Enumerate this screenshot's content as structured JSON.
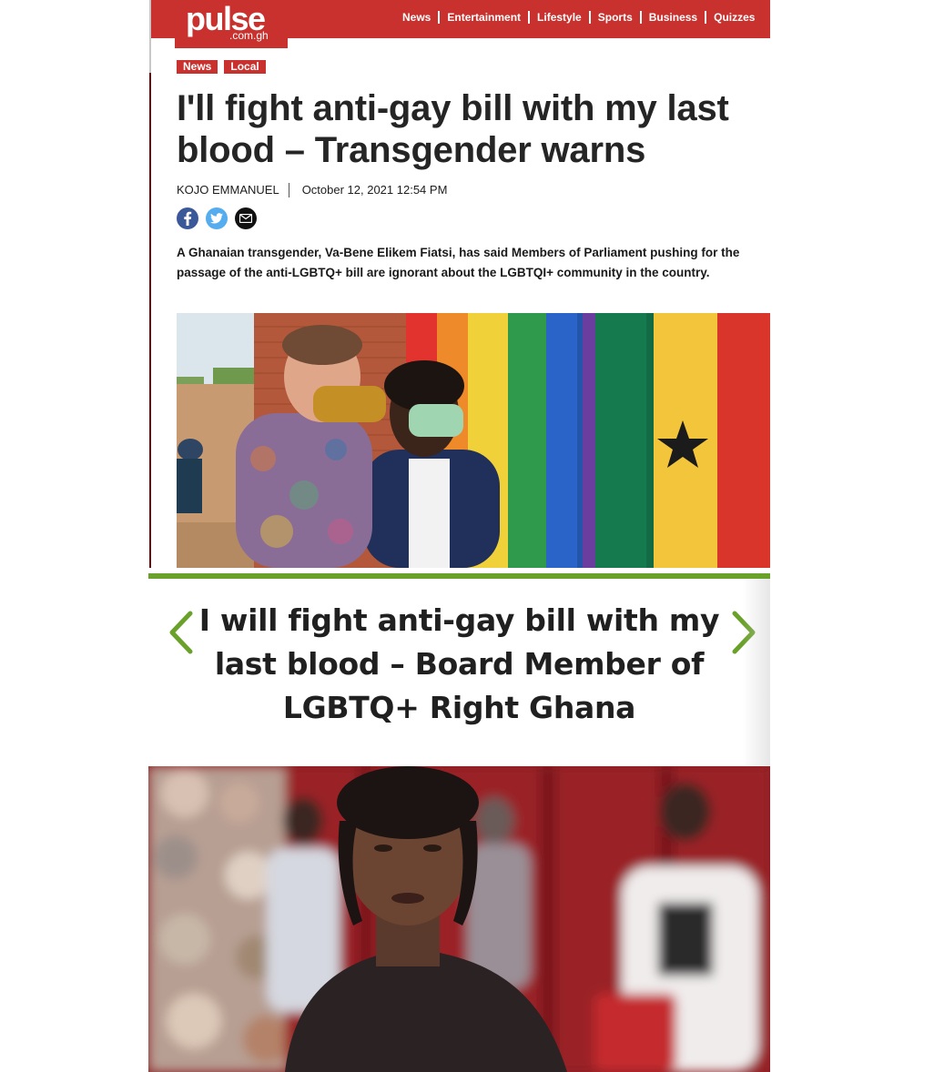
{
  "site": {
    "logo_word": "pulse",
    "logo_domain": ".com.gh",
    "brand_color": "#c8312d",
    "nav": [
      "News",
      "Entertainment",
      "Lifestyle",
      "Sports",
      "Business",
      "Quizzes"
    ]
  },
  "article": {
    "tags": [
      "News",
      "Local"
    ],
    "headline": "I'll fight anti-gay bill with my last blood – Transgender warns",
    "author": "KOJO EMMANUEL",
    "date": "October 12, 2021 12:54 PM",
    "share": [
      "facebook-icon",
      "twitter-icon",
      "mail-icon"
    ],
    "lede": "A Ghanaian transgender, Va-Bene Elikem Fiatsi, has said Members of Parliament pushing for the passage of the anti-LGBTQ+ bill are ignorant about the LGBTQI+ community in the country."
  },
  "card": {
    "accent_color": "#6aa12a",
    "title": "I will fight anti-gay bill with my last blood – Board Member of LGBTQ+ Right Ghana"
  }
}
